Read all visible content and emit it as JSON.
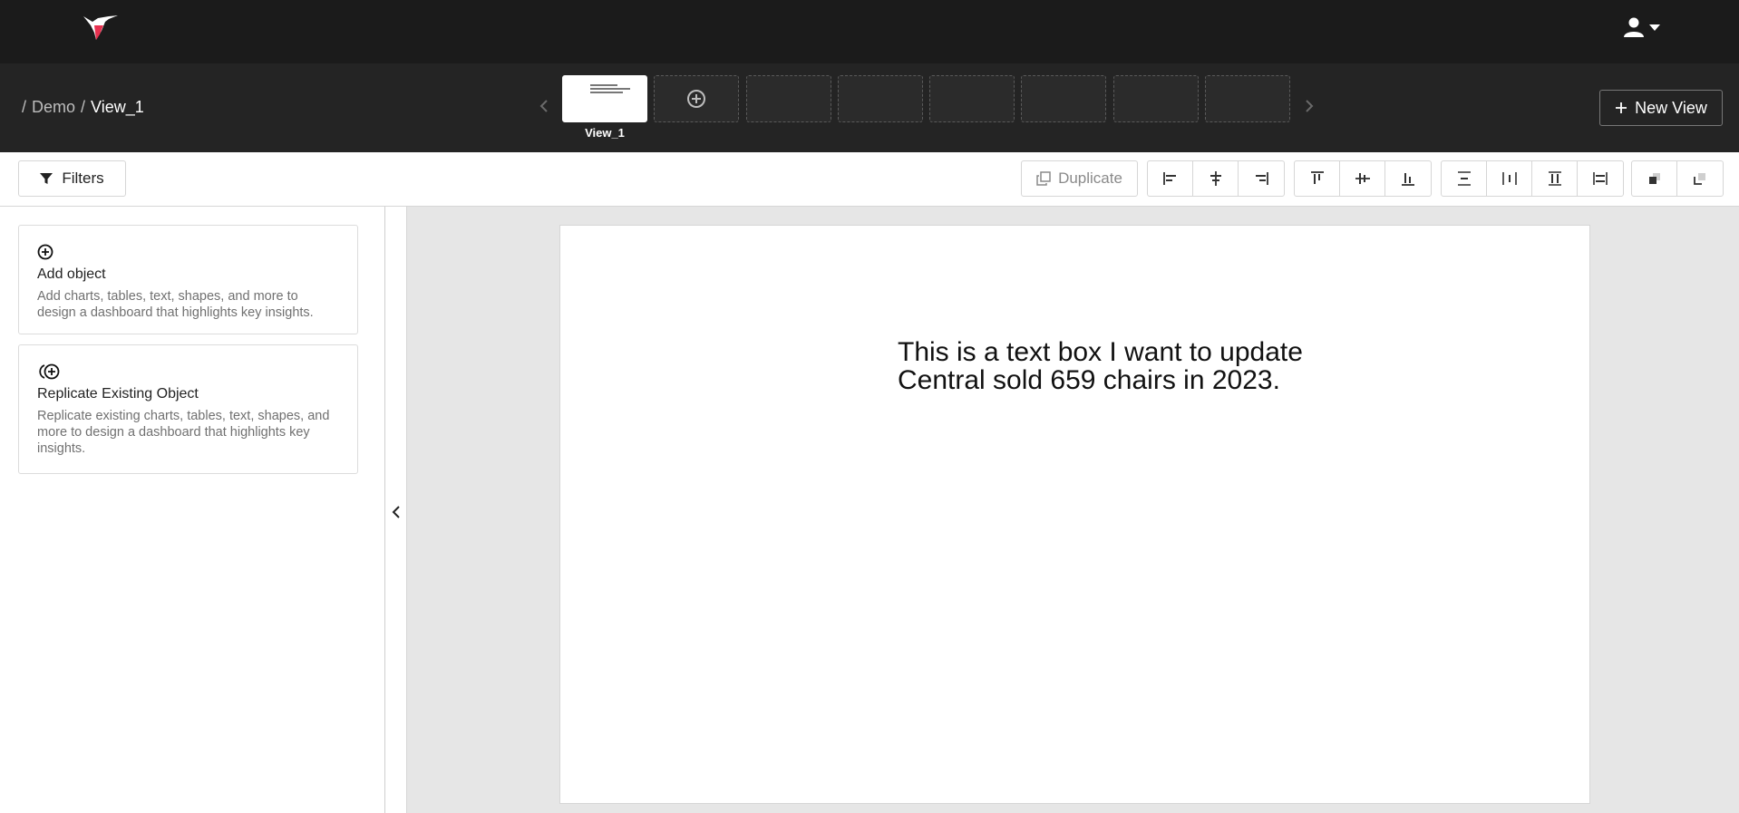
{
  "header": {
    "logo_icon": "hummingbird-logo-icon",
    "user_icon": "user-icon",
    "accent_color": "#e8304f"
  },
  "viewsbar": {
    "breadcrumb": {
      "separator": "/",
      "parent": "Demo",
      "current": "View_1"
    },
    "active_view_label": "View_1",
    "new_view_label": "New View"
  },
  "toolbar": {
    "filters_label": "Filters",
    "duplicate_label": "Duplicate"
  },
  "leftpanel": {
    "cards": [
      {
        "title": "Add object",
        "description": "Add charts, tables, text, shapes, and more to design a dashboard that highlights key insights."
      },
      {
        "title": "Replicate Existing Object",
        "description": "Replicate existing charts, tables, text, shapes, and more to design a dashboard that highlights key insights."
      }
    ]
  },
  "canvas": {
    "textbox_lines": [
      "This is a text box I want to update",
      "Central sold 659 chairs in 2023."
    ]
  }
}
